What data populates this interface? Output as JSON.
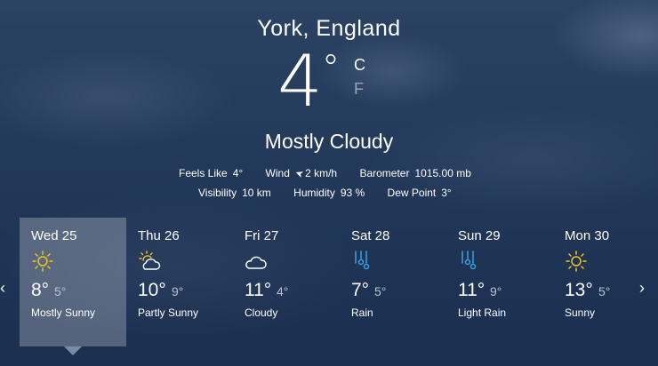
{
  "location": "York, England",
  "current": {
    "temp": "4",
    "degree": "°",
    "unit_c": "C",
    "unit_f": "F",
    "condition": "Mostly Cloudy",
    "details": {
      "feels_like_label": "Feels Like",
      "feels_like": "4°",
      "wind_label": "Wind",
      "wind": "2 km/h",
      "barometer_label": "Barometer",
      "barometer": "1015.00 mb",
      "visibility_label": "Visibility",
      "visibility": "10 km",
      "humidity_label": "Humidity",
      "humidity": "93 %",
      "dew_point_label": "Dew Point",
      "dew_point": "3°"
    }
  },
  "forecast": [
    {
      "day": "Wed 25",
      "hi": "8°",
      "lo": "5°",
      "desc": "Mostly Sunny",
      "icon": "sun-icon"
    },
    {
      "day": "Thu 26",
      "hi": "10°",
      "lo": "9°",
      "desc": "Partly Sunny",
      "icon": "partly-sunny-icon"
    },
    {
      "day": "Fri 27",
      "hi": "11°",
      "lo": "4°",
      "desc": "Cloudy",
      "icon": "cloud-icon"
    },
    {
      "day": "Sat 28",
      "hi": "7°",
      "lo": "5°",
      "desc": "Rain",
      "icon": "rain-icon"
    },
    {
      "day": "Sun 29",
      "hi": "11°",
      "lo": "9°",
      "desc": "Light Rain",
      "icon": "rain-icon"
    },
    {
      "day": "Mon 30",
      "hi": "13°",
      "lo": "5°",
      "desc": "Sunny",
      "icon": "sun-icon"
    }
  ],
  "colors": {
    "sun": "#f5c518",
    "rain": "#3aa0e6",
    "text": "#ffffff"
  },
  "nav": {
    "left": "‹",
    "right": "›"
  }
}
